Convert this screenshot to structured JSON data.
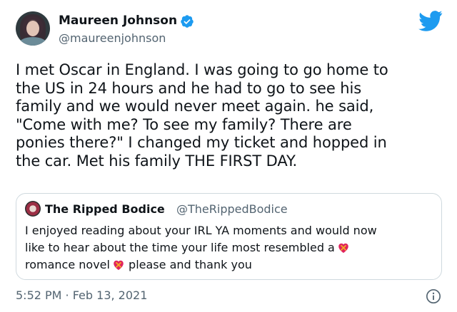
{
  "author": {
    "display_name": "Maureen Johnson",
    "handle": "@maureenjohnson",
    "verified": true
  },
  "tweet": {
    "lines": [
      "I met Oscar in England. I was going to go home to",
      "the US in 24 hours and he had to go to see his",
      "family and we would never meet again. he said,",
      "\"Come with me? To see my family? There are",
      "ponies there?\" I changed my ticket and hopped in",
      "the car. Met his family THE FIRST DAY."
    ],
    "timestamp": "5:52 PM · Feb 13, 2021"
  },
  "quoted_tweet": {
    "display_name": "The Ripped Bodice",
    "handle": "@TheRippedBodice",
    "line1": "I enjoyed reading about your IRL YA  moments and would now",
    "line2": "like to hear about the time your life most resembled a",
    "line3_before": "romance novel",
    "line3_after": " please and thank you"
  },
  "icons": {
    "brand": "twitter-bird-icon",
    "verified": "verified-badge-icon",
    "emoji": "heart-with-ribbon-icon",
    "info": "info-icon"
  },
  "colors": {
    "twitter_blue": "#1d9bf0",
    "text": "#0f1419",
    "secondary_text": "#536471",
    "border": "#cfd9de",
    "heart": "#e0245e"
  }
}
